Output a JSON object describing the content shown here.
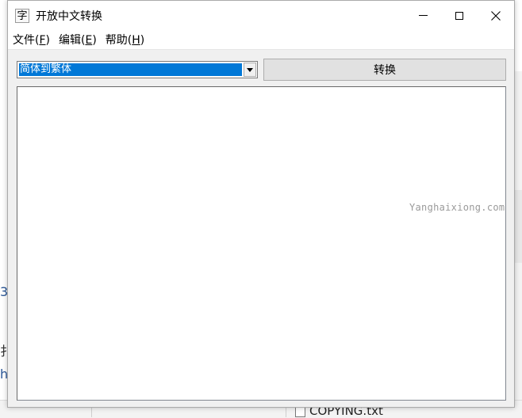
{
  "window": {
    "icon_char": "字",
    "title": "开放中文转换"
  },
  "menu": [
    {
      "label": "文件(",
      "key": "F",
      "suffix": ")"
    },
    {
      "label": "编辑(",
      "key": "E",
      "suffix": ")"
    },
    {
      "label": "帮助(",
      "key": "H",
      "suffix": ")"
    }
  ],
  "toolbar": {
    "mode_selected": "简体到繁体",
    "convert_label": "转换"
  },
  "editor": {
    "text": ""
  },
  "watermark": "Yanghaixiong.com",
  "background": {
    "left_chars": [
      "3",
      "扌",
      "h"
    ],
    "file_name": "COPYING.txt"
  },
  "colors": {
    "selection": "#0078d7",
    "window_bg": "#f0f0f0"
  }
}
